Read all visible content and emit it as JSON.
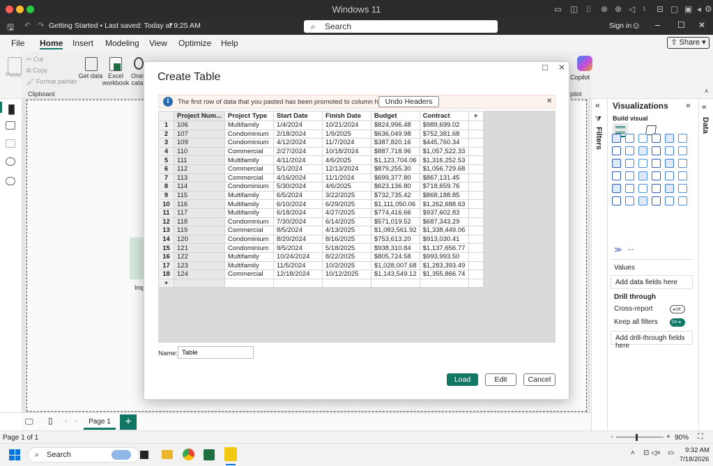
{
  "mac": {
    "title": "Windows 11"
  },
  "titlebar": {
    "doc": "Getting Started • Last saved: Today at 9:25 AM",
    "search": "Search",
    "signin": "Sign in"
  },
  "menu": {
    "items": [
      "File",
      "Home",
      "Insert",
      "Modeling",
      "View",
      "Optimize",
      "Help"
    ],
    "share": "Share"
  },
  "ribbon": {
    "paste": "Paste",
    "cut": "Cut",
    "copy": "Copy",
    "format_painter": "Format painter",
    "clipboard": "Clipboard",
    "get_data": "Get data",
    "excel": "Excel workbook",
    "onelake": "OneL catal",
    "copilot": "Copilot",
    "pilot": "pilot"
  },
  "dialog": {
    "title": "Create Table",
    "info": "The first row of data that you pasted has been promoted to column headers.",
    "undo": "Undo Headers",
    "headers": [
      "Project Num...",
      "Project Type",
      "Start Date",
      "Finish Date",
      "Budget",
      "Contract"
    ],
    "rows": [
      [
        "1",
        "106",
        "Multifamily",
        "1/4/2024",
        "10/21/2024",
        "$824,996.48",
        "$989,699.02"
      ],
      [
        "2",
        "107",
        "Condominium",
        "2/18/2024",
        "1/9/2025",
        "$636,049.98",
        "$752,381.68"
      ],
      [
        "3",
        "109",
        "Condominium",
        "4/12/2024",
        "11/7/2024",
        "$387,820.16",
        "$445,760.34"
      ],
      [
        "4",
        "110",
        "Commercial",
        "2/27/2024",
        "10/18/2024",
        "$887,718.96",
        "$1,057,522.33"
      ],
      [
        "5",
        "111",
        "Multifamily",
        "4/11/2024",
        "4/6/2025",
        "$1,123,704.06",
        "$1,316,252.53"
      ],
      [
        "6",
        "112",
        "Commercial",
        "5/1/2024",
        "12/13/2024",
        "$879,255.30",
        "$1,056,729.68"
      ],
      [
        "7",
        "113",
        "Commercial",
        "4/16/2024",
        "11/1/2024",
        "$699,377.80",
        "$867,131.45"
      ],
      [
        "8",
        "114",
        "Condominium",
        "5/30/2024",
        "4/6/2025",
        "$623,136.80",
        "$718,659.76"
      ],
      [
        "9",
        "115",
        "Multifamily",
        "6/5/2024",
        "3/22/2025",
        "$732,735.42",
        "$868,188.85"
      ],
      [
        "10",
        "116",
        "Multifamily",
        "6/10/2024",
        "6/29/2025",
        "$1,111,050.06",
        "$1,262,688.63"
      ],
      [
        "11",
        "117",
        "Multifamily",
        "6/18/2024",
        "4/27/2025",
        "$774,416.66",
        "$937,602.83"
      ],
      [
        "12",
        "118",
        "Condominium",
        "7/30/2024",
        "6/14/2025",
        "$571,019.52",
        "$687,343.29"
      ],
      [
        "13",
        "119",
        "Commercial",
        "8/5/2024",
        "4/13/2025",
        "$1,083,561.92",
        "$1,338,449.06"
      ],
      [
        "14",
        "120",
        "Condominium",
        "8/20/2024",
        "8/16/2025",
        "$753,613.20",
        "$913,030.41"
      ],
      [
        "15",
        "121",
        "Condominium",
        "9/5/2024",
        "5/18/2025",
        "$938,310.84",
        "$1,137,656.77"
      ],
      [
        "16",
        "122",
        "Multifamily",
        "10/24/2024",
        "8/22/2025",
        "$805,724.58",
        "$993,993.50"
      ],
      [
        "17",
        "123",
        "Multifamily",
        "11/5/2024",
        "10/2/2025",
        "$1,028,007.68",
        "$1,283,393.49"
      ],
      [
        "18",
        "124",
        "Commercial",
        "12/18/2024",
        "10/12/2025",
        "$1,143,549.12",
        "$1,355,866.74"
      ]
    ],
    "add_row": "+",
    "add_col": "+",
    "name_label": "Name:",
    "name_value": "Table",
    "load": "Load",
    "edit": "Edit",
    "cancel": "Cancel"
  },
  "viz": {
    "title": "Visualizations",
    "build": "Build visual",
    "values": "Values",
    "add_fields": "Add data fields here",
    "drill": "Drill through",
    "cross": "Cross-report",
    "cross_state": "Off",
    "keep": "Keep all filters",
    "keep_state": "On",
    "add_drill": "Add drill-through fields here",
    "filters": "Filters",
    "data": "Data",
    "more": "..."
  },
  "canvas": {
    "imp": "Imp"
  },
  "pages": {
    "tab": "Page 1"
  },
  "status": {
    "page": "Page 1 of 1",
    "zoom": "90%"
  },
  "taskbar": {
    "search": "Search",
    "time": "9:32 AM",
    "date": "7/18/2026"
  },
  "colors": {
    "accent": "#117865",
    "powerbi": "#f2c811",
    "taskbar_bg": "#f2f2f2"
  }
}
